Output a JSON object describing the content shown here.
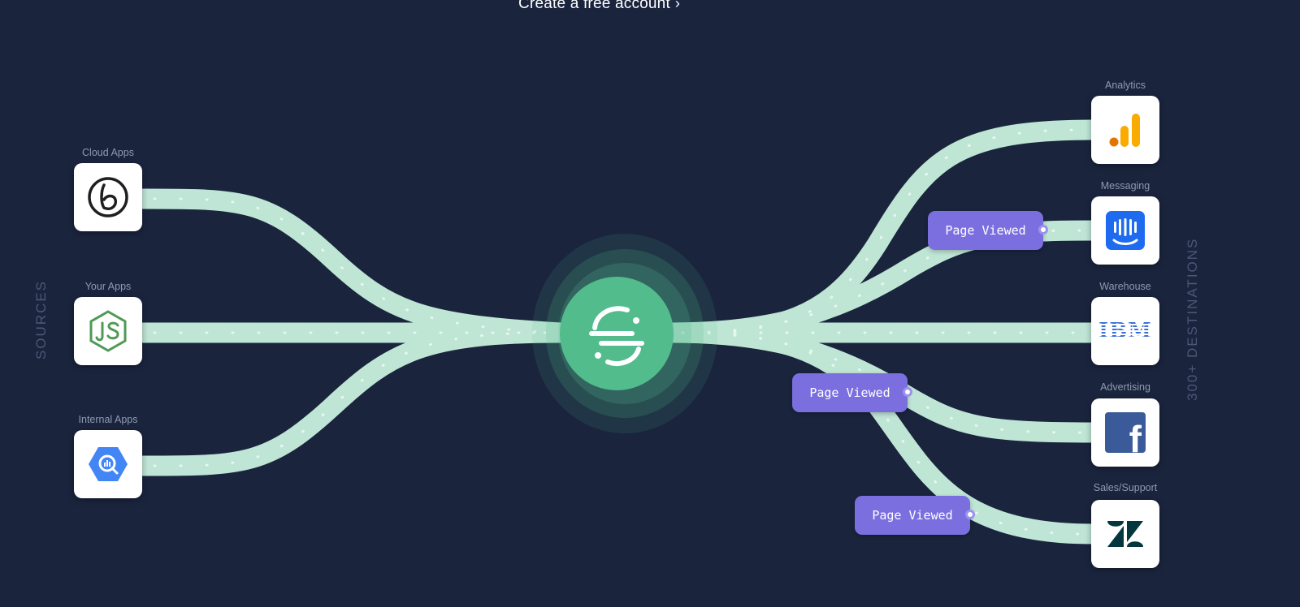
{
  "cta": {
    "label": "Create a free account",
    "arrow": "›"
  },
  "side_labels": {
    "sources": "SOURCES",
    "destinations": "300+ DESTINATIONS"
  },
  "sources": [
    {
      "category": "Cloud Apps",
      "icon": "braze-icon"
    },
    {
      "category": "Your Apps",
      "icon": "nodejs-icon"
    },
    {
      "category": "Internal Apps",
      "icon": "bigquery-icon"
    }
  ],
  "destinations": [
    {
      "category": "Analytics",
      "icon": "google-analytics-icon"
    },
    {
      "category": "Messaging",
      "icon": "intercom-icon"
    },
    {
      "category": "Warehouse",
      "icon": "ibm-icon",
      "logo_text": "IBM"
    },
    {
      "category": "Advertising",
      "icon": "facebook-icon",
      "logo_text": "f"
    },
    {
      "category": "Sales/Support",
      "icon": "zendesk-icon"
    }
  ],
  "events": [
    {
      "label": "Page Viewed"
    },
    {
      "label": "Page Viewed"
    },
    {
      "label": "Page Viewed"
    }
  ],
  "hub": {
    "icon": "segment-logo-icon"
  },
  "colors": {
    "background": "#1a243d",
    "pipe": "#c8f0de",
    "pipe_dots": "#eafaf2",
    "hub": "#52bc8d",
    "event_chip": "#7b6fe0",
    "side_label": "#4a5877",
    "category_label": "#8e99b2"
  }
}
